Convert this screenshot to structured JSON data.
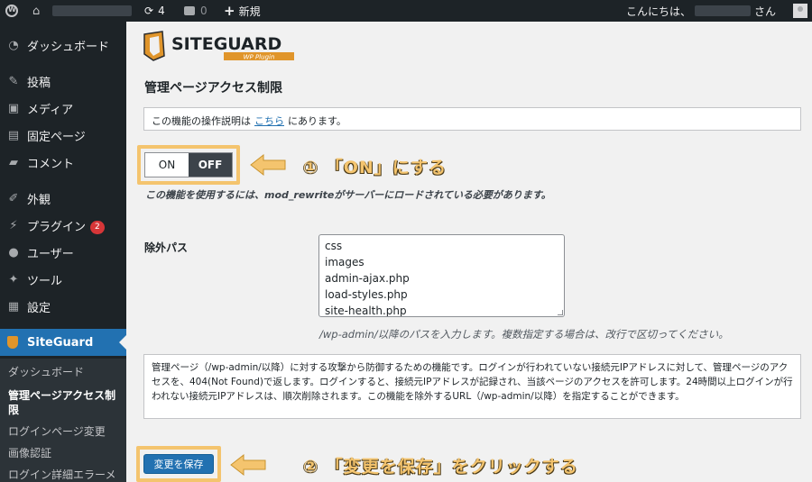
{
  "adminbar": {
    "updates_count": "4",
    "comments_count": "0",
    "new_label": "新規",
    "howdy_prefix": "こんにちは、",
    "howdy_suffix": "さん"
  },
  "sidebar": {
    "items": [
      {
        "label": "ダッシュボード",
        "icon": "dashboard-icon"
      },
      {
        "label": "投稿",
        "icon": "pin-icon"
      },
      {
        "label": "メディア",
        "icon": "media-icon"
      },
      {
        "label": "固定ページ",
        "icon": "page-icon"
      },
      {
        "label": "コメント",
        "icon": "comment-icon"
      },
      {
        "label": "外観",
        "icon": "brush-icon"
      },
      {
        "label": "プラグイン",
        "icon": "plugin-icon",
        "badge": "2"
      },
      {
        "label": "ユーザー",
        "icon": "user-icon"
      },
      {
        "label": "ツール",
        "icon": "wrench-icon"
      },
      {
        "label": "設定",
        "icon": "settings-icon"
      },
      {
        "label": "SiteGuard",
        "icon": "siteguard-icon"
      }
    ],
    "submenu": [
      "ダッシュボード",
      "管理ページアクセス制",
      "限",
      "ログインページ変更",
      "画像認証",
      "ログイン詳細エラーメ"
    ]
  },
  "logo": {
    "main": "SITEGUARD",
    "sub": "WP Plugin"
  },
  "page": {
    "title": "管理ページアクセス制限",
    "notice_prefix": "この機能の操作説明は",
    "notice_link": "こちら",
    "notice_suffix": "にあります。",
    "toggle_on": "ON",
    "toggle_off": "OFF",
    "requirement_note": "この機能を使用するには、mod_rewriteがサーバーにロードされている必要があります。",
    "exclude_label": "除外パス",
    "exclude_paths": [
      "css",
      "images",
      "admin-ajax.php",
      "load-styles.php",
      "site-health.php"
    ],
    "path_help": "/wp-admin/以降のパスを入力します。複数指定する場合は、改行で区切ってください。",
    "description": "管理ページ（/wp-admin/以降）に対する攻撃から防御するための機能です。ログインが行われていない接続元IPアドレスに対して、管理ページのアクセスを、404(Not Found)で返します。ログインすると、接続元IPアドレスが記録され、当該ページのアクセスを許可します。24時間以上ログインが行われない接続元IPアドレスは、順次削除されます。この機能を除外するURL（/wp-admin/以降）を指定することができます。",
    "save_button": "変更を保存"
  },
  "annotations": {
    "step1": "① 「ON」にする",
    "step2": "② 「変更を保存」をクリックする",
    "color": "#f4c46e"
  }
}
